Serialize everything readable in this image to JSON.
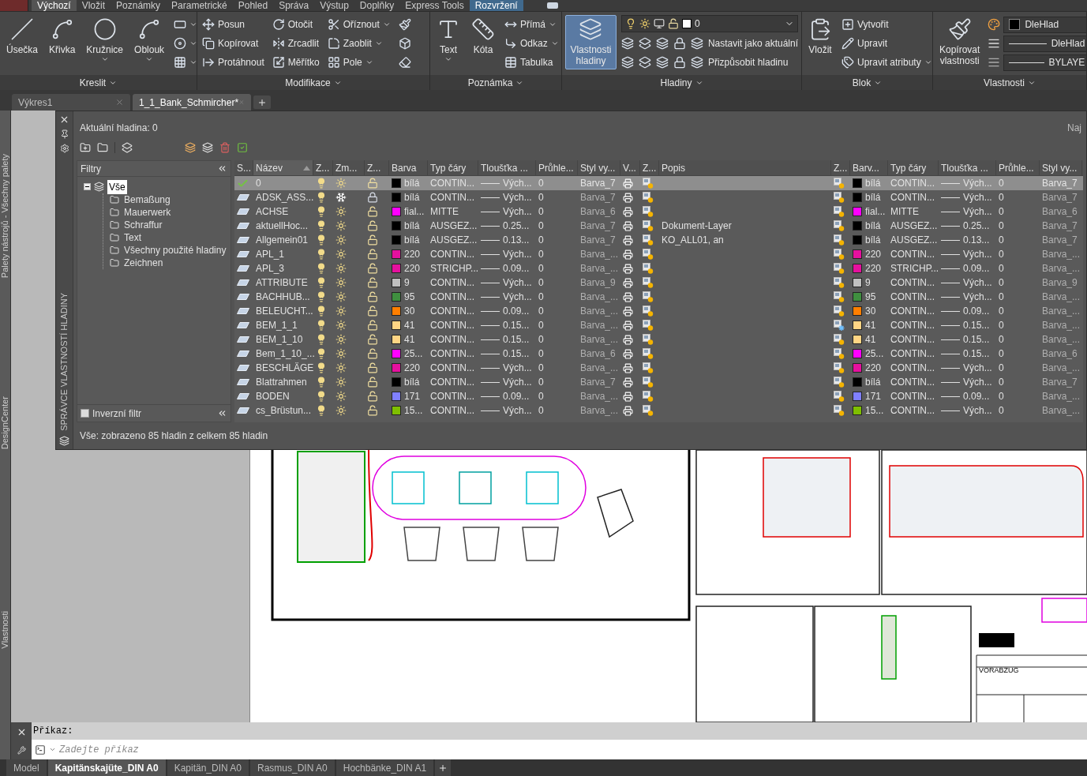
{
  "menu_tabs": [
    {
      "label": "Výchozí",
      "selected": true,
      "contextual": false
    },
    {
      "label": "Vložit",
      "selected": false,
      "contextual": false
    },
    {
      "label": "Poznámky",
      "selected": false,
      "contextual": false
    },
    {
      "label": "Parametrické",
      "selected": false,
      "contextual": false
    },
    {
      "label": "Pohled",
      "selected": false,
      "contextual": false
    },
    {
      "label": "Správa",
      "selected": false,
      "contextual": false
    },
    {
      "label": "Výstup",
      "selected": false,
      "contextual": false
    },
    {
      "label": "Doplňky",
      "selected": false,
      "contextual": false
    },
    {
      "label": "Express Tools",
      "selected": false,
      "contextual": false
    },
    {
      "label": "Rozvržení",
      "selected": false,
      "contextual": true
    }
  ],
  "ribbon": {
    "panels": [
      {
        "title": "Kreslit",
        "columns": [
          {
            "kind": "large",
            "label": "Úsečka",
            "dropdown": false,
            "selected": false
          },
          {
            "kind": "large",
            "label": "Křivka",
            "dropdown": false,
            "selected": false
          },
          {
            "kind": "large",
            "label": "Kružnice",
            "dropdown": true,
            "selected": false
          },
          {
            "kind": "large",
            "label": "Oblouk",
            "dropdown": true,
            "selected": false
          },
          {
            "kind": "stack",
            "items": [
              {
                "dropdown": true
              },
              {
                "dropdown": true
              },
              {
                "dropdown": true
              }
            ]
          }
        ]
      },
      {
        "title": "Modifikace",
        "columns": [
          {
            "kind": "stack",
            "items": [
              {
                "label": "Posun",
                "dropdown": false
              },
              {
                "label": "Kopírovat",
                "dropdown": false
              },
              {
                "label": "Protáhnout",
                "dropdown": false
              }
            ]
          },
          {
            "kind": "stack",
            "items": [
              {
                "label": "Otočit",
                "dropdown": false
              },
              {
                "label": "Zrcadlit",
                "dropdown": false
              },
              {
                "label": "Měřítko",
                "dropdown": false
              }
            ]
          },
          {
            "kind": "stack",
            "items": [
              {
                "label": "Oříznout",
                "dropdown": true
              },
              {
                "label": "Zaoblit",
                "dropdown": true
              },
              {
                "label": "Pole",
                "dropdown": true
              }
            ]
          },
          {
            "kind": "stack",
            "items": [
              {
                "dropdown": false
              },
              {
                "dropdown": false
              },
              {
                "dropdown": false
              }
            ]
          }
        ]
      },
      {
        "title": "Poznámka",
        "columns": [
          {
            "kind": "large",
            "label": "Text",
            "dropdown": true,
            "selected": false
          },
          {
            "kind": "large",
            "label": "Kóta",
            "dropdown": false,
            "selected": false
          },
          {
            "kind": "stack",
            "items": [
              {
                "label": "Přímá",
                "dropdown": true
              },
              {
                "label": "Odkaz",
                "dropdown": true
              },
              {
                "label": "Tabulka",
                "dropdown": false
              }
            ]
          }
        ]
      },
      {
        "title": "Hladiny",
        "columns": [
          {
            "kind": "large",
            "label": "Vlastnosti hladiny",
            "dropdown": false,
            "selected": true
          },
          {
            "kind": "layers",
            "combo": "0",
            "rows": [
              "Nastavit jako aktuální",
              "Přizpůsobit hladinu"
            ]
          }
        ]
      },
      {
        "title": "Blok",
        "columns": [
          {
            "kind": "large",
            "label": "Vložit",
            "dropdown": false,
            "selected": false
          },
          {
            "kind": "stack",
            "items": [
              {
                "label": "Vytvořit",
                "dropdown": false
              },
              {
                "label": "Upravit",
                "dropdown": false
              },
              {
                "label": "Upravit atributy",
                "dropdown": true
              }
            ]
          }
        ]
      },
      {
        "title": "Vlastnosti",
        "columns": [
          {
            "kind": "large",
            "label": "Kopírovat vlastnosti",
            "dropdown": false,
            "selected": false
          },
          {
            "kind": "props",
            "items": [
              {
                "kind": "color",
                "value": "DleHlad"
              },
              {
                "kind": "lineweight",
                "value": "DleHlad"
              },
              {
                "kind": "linetype",
                "value": "BYLAYE"
              }
            ]
          }
        ]
      }
    ]
  },
  "file_tabs": [
    {
      "label": "Výkres1",
      "selected": false
    },
    {
      "label": "1_1_Bank_Schmircher*",
      "selected": true
    }
  ],
  "side_palettes": [
    "Palety nástrojů - Všechny palety",
    "DesignCenter",
    "Vlastnosti"
  ],
  "layer_manager": {
    "title": "SPRÁVCE VLASTNOSTÍ HLADINY",
    "current_layer": "Aktuální hladina: 0",
    "search": {
      "placeholder": "Naj"
    },
    "filters": {
      "title": "Filtry",
      "tree": [
        {
          "label": "Vše",
          "selected": true,
          "expanded": true,
          "children": [
            {
              "label": "Bemaßung",
              "selected": false
            },
            {
              "label": "Mauerwerk",
              "selected": false
            },
            {
              "label": "Schraffur",
              "selected": false
            },
            {
              "label": "Text",
              "selected": false
            },
            {
              "label": "Všechny použité hladiny",
              "selected": false
            },
            {
              "label": "Zeichnen",
              "selected": false
            }
          ]
        }
      ],
      "invert": {
        "label": "Inverzní filtr",
        "checked": false
      }
    },
    "columns": [
      {
        "label": "S...",
        "kind": "status",
        "sorted": false
      },
      {
        "label": "Název",
        "kind": "name",
        "sorted": true
      },
      {
        "label": "Z...",
        "kind": "on",
        "sorted": false
      },
      {
        "label": "Zm...",
        "kind": "freeze",
        "sorted": false
      },
      {
        "label": "Z...",
        "kind": "lock",
        "sorted": false
      },
      {
        "label": "Barva",
        "kind": "color",
        "sorted": false
      },
      {
        "label": "Typ čáry",
        "kind": "linetype",
        "sorted": false
      },
      {
        "label": "Tloušťka ...",
        "kind": "lineweight",
        "sorted": false
      },
      {
        "label": "Průhle...",
        "kind": "transparency",
        "sorted": false
      },
      {
        "label": "Styl vy...",
        "kind": "plot_style",
        "sorted": false
      },
      {
        "label": "V...",
        "kind": "plot",
        "sorted": false
      },
      {
        "label": "Z...",
        "kind": "newvp",
        "sorted": false
      },
      {
        "label": "Popis",
        "kind": "description",
        "sorted": false
      },
      {
        "label": "Z...",
        "kind": "vp_freeze",
        "sorted": false
      },
      {
        "label": "Barv...",
        "kind": "vp_color",
        "sorted": false
      },
      {
        "label": "Typ čáry",
        "kind": "vp_linetype",
        "sorted": false
      },
      {
        "label": "Tloušťka ...",
        "kind": "vp_lineweight",
        "sorted": false
      },
      {
        "label": "Průhle...",
        "kind": "vp_transparency",
        "sorted": false
      },
      {
        "label": "Styl vy...",
        "kind": "vp_plot_style",
        "sorted": false
      }
    ],
    "rows": [
      {
        "selected": true,
        "current": true,
        "name": "0",
        "on": true,
        "frozen": false,
        "locked": false,
        "color": "#000000",
        "color_name": "bílá",
        "linetype": "CONTIN...",
        "lineweight": "Vých...",
        "transparency": "0",
        "plot_style": "Barva_7",
        "plot": true,
        "vp_frozen": false,
        "vp_color_name": "bílá",
        "vp_linetype": "CONTIN...",
        "vp_lineweight": "Vých...",
        "vp_transparency": "0",
        "vp_plot_style": "Barva_7"
      },
      {
        "selected": false,
        "current": false,
        "name": "ADSK_ASS...",
        "on": true,
        "frozen": true,
        "locked": true,
        "color": "#000000",
        "color_name": "bílá",
        "linetype": "CONTIN...",
        "lineweight": "Vých...",
        "transparency": "0",
        "plot_style": "Barva_7",
        "plot": true,
        "vp_frozen": false,
        "vp_color_name": "bílá",
        "vp_linetype": "CONTIN...",
        "vp_lineweight": "Vých...",
        "vp_transparency": "0",
        "vp_plot_style": "Barva_7"
      },
      {
        "selected": false,
        "current": false,
        "name": "ACHSE",
        "on": true,
        "frozen": false,
        "locked": false,
        "color": "#ff00ff",
        "color_name": "fial...",
        "linetype": "MITTE",
        "lineweight": "Vých...",
        "transparency": "0",
        "plot_style": "Barva_6",
        "plot": true,
        "vp_frozen": false,
        "vp_color_name": "fial...",
        "vp_linetype": "MITTE",
        "vp_lineweight": "Vých...",
        "vp_transparency": "0",
        "vp_plot_style": "Barva_6"
      },
      {
        "selected": false,
        "current": false,
        "name": "aktuellHoc...",
        "on": true,
        "frozen": false,
        "locked": false,
        "color": "#000000",
        "color_name": "bílá",
        "linetype": "AUSGEZ...",
        "lineweight": "0.25...",
        "transparency": "0",
        "plot_style": "Barva_7",
        "plot": true,
        "description": "Dokument-Layer",
        "vp_frozen": false,
        "vp_color_name": "bílá",
        "vp_linetype": "AUSGEZ...",
        "vp_lineweight": "0.25...",
        "vp_transparency": "0",
        "vp_plot_style": "Barva_7"
      },
      {
        "selected": false,
        "current": false,
        "name": "Allgemein01",
        "on": true,
        "frozen": false,
        "locked": false,
        "color": "#000000",
        "color_name": "bílá",
        "linetype": "AUSGEZ...",
        "lineweight": "0.13...",
        "transparency": "0",
        "plot_style": "Barva_7",
        "plot": true,
        "description": "KO_ALL01, an",
        "vp_frozen": false,
        "vp_color_name": "bílá",
        "vp_linetype": "AUSGEZ...",
        "vp_lineweight": "0.13...",
        "vp_transparency": "0",
        "vp_plot_style": "Barva_7"
      },
      {
        "selected": false,
        "current": false,
        "name": "APL_1",
        "on": true,
        "frozen": false,
        "locked": false,
        "color": "#e6109e",
        "color_name": "220",
        "linetype": "CONTIN...",
        "lineweight": "Vých...",
        "transparency": "0",
        "plot_style": "Barva_...",
        "plot": true,
        "vp_frozen": false,
        "vp_color_name": "220",
        "vp_linetype": "CONTIN...",
        "vp_lineweight": "Vých...",
        "vp_transparency": "0",
        "vp_plot_style": "Barva_..."
      },
      {
        "selected": false,
        "current": false,
        "name": "APL_3",
        "on": true,
        "frozen": false,
        "locked": false,
        "color": "#e6109e",
        "color_name": "220",
        "linetype": "STRICHP...",
        "lineweight": "0.09...",
        "transparency": "0",
        "plot_style": "Barva_...",
        "plot": true,
        "vp_frozen": false,
        "vp_color_name": "220",
        "vp_linetype": "STRICHP...",
        "vp_lineweight": "0.09...",
        "vp_transparency": "0",
        "vp_plot_style": "Barva_..."
      },
      {
        "selected": false,
        "current": false,
        "name": "ATTRIBUTE",
        "on": true,
        "frozen": false,
        "locked": false,
        "color": "#c0c0c0",
        "color_name": "9",
        "linetype": "CONTIN...",
        "lineweight": "Vých...",
        "transparency": "0",
        "plot_style": "Barva_9",
        "plot": true,
        "vp_frozen": false,
        "vp_color_name": "9",
        "vp_linetype": "CONTIN...",
        "vp_lineweight": "Vých...",
        "vp_transparency": "0",
        "vp_plot_style": "Barva_9"
      },
      {
        "selected": false,
        "current": false,
        "name": "BACHHUB...",
        "on": true,
        "frozen": false,
        "locked": false,
        "color": "#3f8f3f",
        "color_name": "95",
        "linetype": "CONTIN...",
        "lineweight": "Vých...",
        "transparency": "0",
        "plot_style": "Barva_...",
        "plot": true,
        "vp_frozen": false,
        "vp_color_name": "95",
        "vp_linetype": "CONTIN...",
        "vp_lineweight": "Vých...",
        "vp_transparency": "0",
        "vp_plot_style": "Barva_..."
      },
      {
        "selected": false,
        "current": false,
        "name": "BELEUCHT...",
        "on": true,
        "frozen": false,
        "locked": false,
        "color": "#ff7f00",
        "color_name": "30",
        "linetype": "CONTIN...",
        "lineweight": "0.09...",
        "transparency": "0",
        "plot_style": "Barva_...",
        "plot": true,
        "vp_frozen": false,
        "vp_color_name": "30",
        "vp_linetype": "CONTIN...",
        "vp_lineweight": "0.09...",
        "vp_transparency": "0",
        "vp_plot_style": "Barva_..."
      },
      {
        "selected": false,
        "current": false,
        "name": "BEM_1_1",
        "on": true,
        "frozen": false,
        "locked": false,
        "color": "#ffd584",
        "color_name": "41",
        "linetype": "CONTIN...",
        "lineweight": "0.15...",
        "transparency": "0",
        "plot_style": "Barva_...",
        "plot": true,
        "vp_frozen": true,
        "vp_color_name": "41",
        "vp_linetype": "CONTIN...",
        "vp_lineweight": "0.15...",
        "vp_transparency": "0",
        "vp_plot_style": "Barva_..."
      },
      {
        "selected": false,
        "current": false,
        "name": "BEM_1_10",
        "on": true,
        "frozen": false,
        "locked": false,
        "color": "#ffd584",
        "color_name": "41",
        "linetype": "CONTIN...",
        "lineweight": "0.15...",
        "transparency": "0",
        "plot_style": "Barva_...",
        "plot": true,
        "vp_frozen": false,
        "vp_color_name": "41",
        "vp_linetype": "CONTIN...",
        "vp_lineweight": "0.15...",
        "vp_transparency": "0",
        "vp_plot_style": "Barva_..."
      },
      {
        "selected": false,
        "current": false,
        "name": "Bem_1_10_...",
        "on": true,
        "frozen": false,
        "locked": false,
        "color": "#ff00ff",
        "color_name": "25...",
        "linetype": "CONTIN...",
        "lineweight": "0.15...",
        "transparency": "0",
        "plot_style": "Barva_6",
        "plot": true,
        "vp_frozen": false,
        "vp_color_name": "25...",
        "vp_linetype": "CONTIN...",
        "vp_lineweight": "0.15...",
        "vp_transparency": "0",
        "vp_plot_style": "Barva_6"
      },
      {
        "selected": false,
        "current": false,
        "name": "BESCHLÄGE",
        "on": true,
        "frozen": false,
        "locked": false,
        "color": "#e6109e",
        "color_name": "220",
        "linetype": "CONTIN...",
        "lineweight": "Vých...",
        "transparency": "0",
        "plot_style": "Barva_...",
        "plot": true,
        "vp_frozen": false,
        "vp_color_name": "220",
        "vp_linetype": "CONTIN...",
        "vp_lineweight": "Vých...",
        "vp_transparency": "0",
        "vp_plot_style": "Barva_..."
      },
      {
        "selected": false,
        "current": false,
        "name": "Blattrahmen",
        "on": true,
        "frozen": false,
        "locked": false,
        "color": "#000000",
        "color_name": "bílá",
        "linetype": "CONTIN...",
        "lineweight": "Vých...",
        "transparency": "0",
        "plot_style": "Barva_7",
        "plot": true,
        "vp_frozen": false,
        "vp_color_name": "bílá",
        "vp_linetype": "CONTIN...",
        "vp_lineweight": "Vých...",
        "vp_transparency": "0",
        "vp_plot_style": "Barva_7"
      },
      {
        "selected": false,
        "current": false,
        "name": "BODEN",
        "on": true,
        "frozen": false,
        "locked": false,
        "color": "#8080ff",
        "color_name": "171",
        "linetype": "CONTIN...",
        "lineweight": "0.09...",
        "transparency": "0",
        "plot_style": "Barva_...",
        "plot": true,
        "vp_frozen": false,
        "vp_color_name": "171",
        "vp_linetype": "CONTIN...",
        "vp_lineweight": "0.09...",
        "vp_transparency": "0",
        "vp_plot_style": "Barva_..."
      },
      {
        "selected": false,
        "current": false,
        "name": "cs_Brüstun...",
        "on": true,
        "frozen": false,
        "locked": false,
        "color": "#7fbf00",
        "color_name": "15...",
        "linetype": "CONTIN...",
        "lineweight": "Vých...",
        "transparency": "0",
        "plot_style": "Barva_...",
        "plot": true,
        "vp_frozen": false,
        "vp_color_name": "15...",
        "vp_linetype": "CONTIN...",
        "vp_lineweight": "Vých...",
        "vp_transparency": "0",
        "vp_plot_style": "Barva_..."
      }
    ],
    "status": "Vše: zobrazeno 85 hladin z celkem 85 hladin"
  },
  "drawing": {
    "label": "VORABZUG"
  },
  "command_line": {
    "history": "Příkaz:",
    "placeholder": "Zadejte příkaz"
  },
  "layout_tabs": [
    {
      "label": "Model",
      "selected": false
    },
    {
      "label": "Kapitänskajüte_DIN A0",
      "selected": true
    },
    {
      "label": "Kapitän_DIN A0",
      "selected": false
    },
    {
      "label": "Rasmus_DIN A0",
      "selected": false
    },
    {
      "label": "Hochbänke_DIN A1",
      "selected": false
    }
  ]
}
